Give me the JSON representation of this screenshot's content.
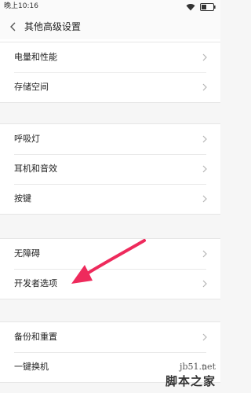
{
  "status_bar": {
    "time": "晚上10:16",
    "icons": [
      "wifi-icon",
      "battery-icon"
    ]
  },
  "header": {
    "title": "其他高级设置",
    "back_icon": "chevron-left-icon"
  },
  "groups": [
    {
      "items": [
        {
          "label": "电量和性能"
        },
        {
          "label": "存储空间"
        }
      ]
    },
    {
      "items": [
        {
          "label": "呼吸灯"
        },
        {
          "label": "耳机和音效"
        },
        {
          "label": "按键"
        }
      ]
    },
    {
      "items": [
        {
          "label": "无障碍"
        },
        {
          "label": "开发者选项"
        }
      ]
    },
    {
      "items": [
        {
          "label": "备份和重置"
        },
        {
          "label": "一键换机"
        }
      ]
    }
  ],
  "annotation": {
    "color": "#ee2a5c",
    "target": "开发者选项"
  },
  "watermark": {
    "url": "jb51.net",
    "site": "脚本之家"
  }
}
